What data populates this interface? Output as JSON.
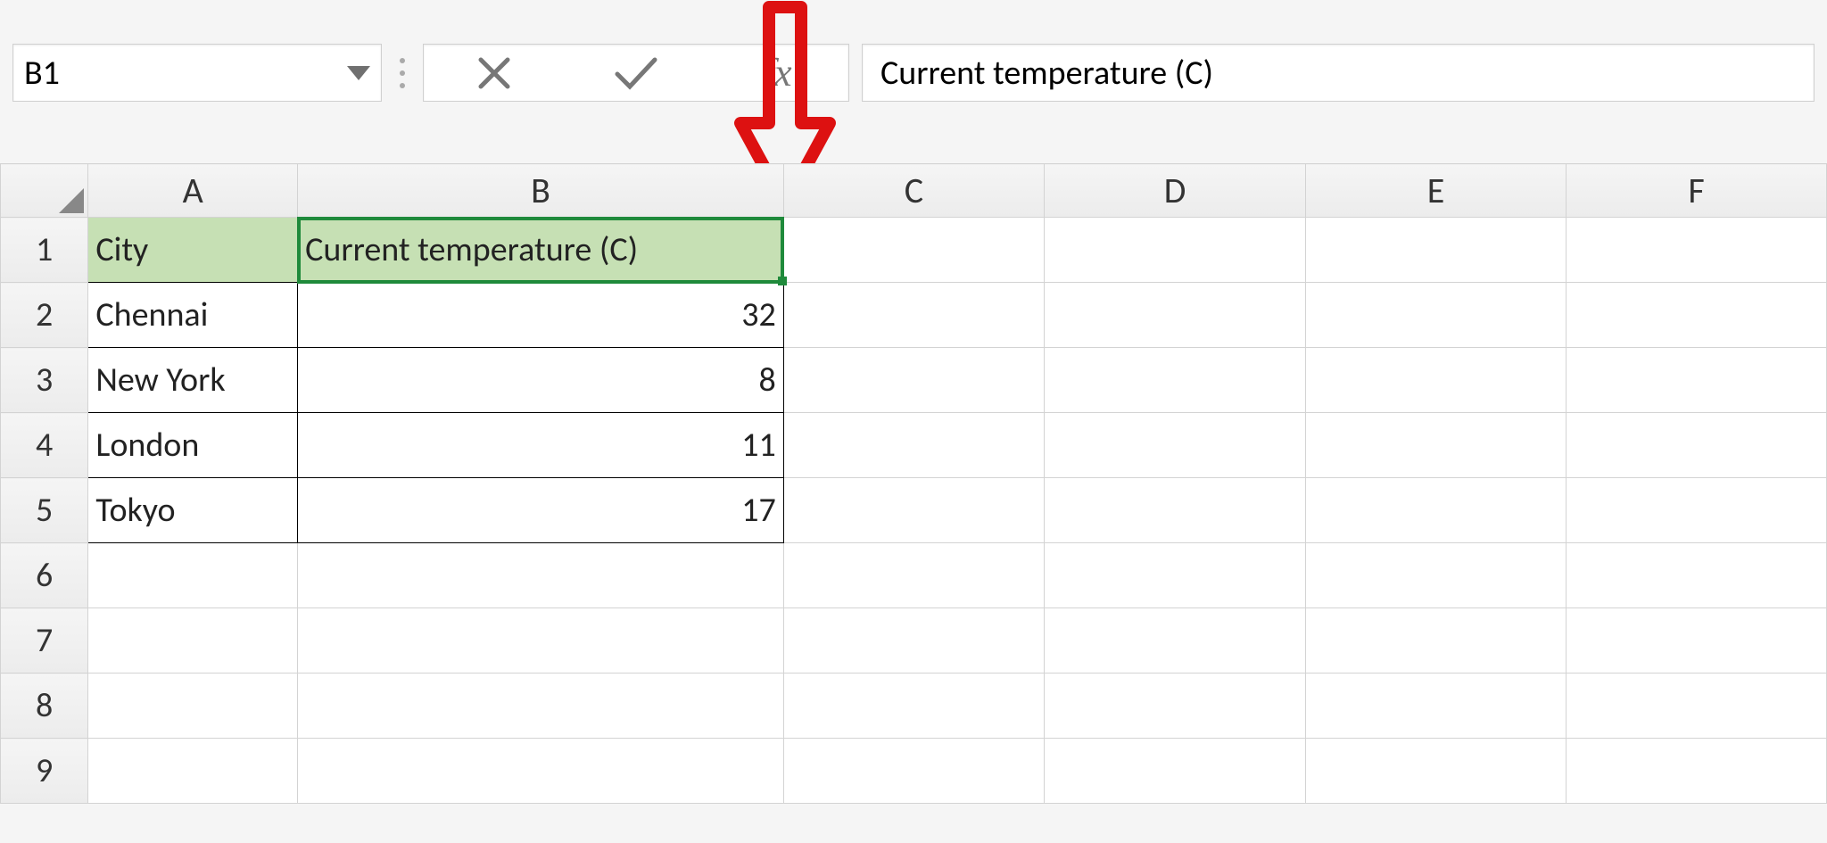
{
  "name_box": "B1",
  "formula_bar_value": "Current temperature (C)",
  "fx_label": "fx",
  "columns": [
    "A",
    "B",
    "C",
    "D",
    "E",
    "F"
  ],
  "rows": [
    "1",
    "2",
    "3",
    "4",
    "5",
    "6",
    "7",
    "8",
    "9"
  ],
  "table": {
    "headers": {
      "A1": "City",
      "B1": "Current temperature (C)"
    },
    "data": [
      {
        "city": "Chennai",
        "temp": "32"
      },
      {
        "city": "New York",
        "temp": "8"
      },
      {
        "city": "London",
        "temp": "11"
      },
      {
        "city": "Tokyo",
        "temp": "17"
      }
    ]
  },
  "active_cell": "B1"
}
